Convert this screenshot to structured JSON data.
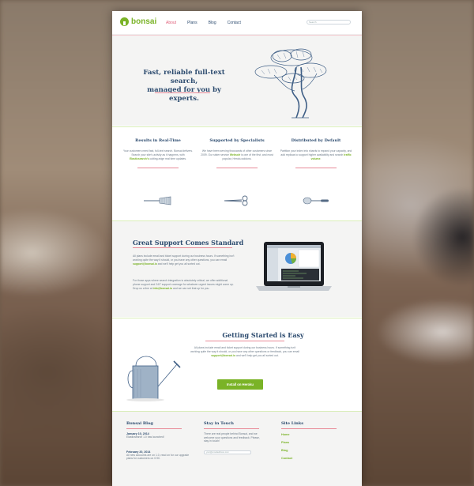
{
  "brand": {
    "name": "bonsai",
    "color": "#7ab327"
  },
  "nav": {
    "items": [
      "About",
      "Plans",
      "Blog",
      "Contact"
    ],
    "active": "About"
  },
  "search": {
    "placeholder": "Search"
  },
  "hero": {
    "title_line1": "Fast, reliable full-text search,",
    "title_line2": "managed for you by experts."
  },
  "features": [
    {
      "title": "Results in Real-Time",
      "text_a": "Your customers need fast, full-text search. Bonsai delivers. Search your site's activity as it happens, with ",
      "link": "Elasticsearch's",
      "text_b": " cutting-edge real time updates.",
      "icon": "broom-icon"
    },
    {
      "title": "Supported by Specialists",
      "text_a": "We have been serving thousands of other customers since 2009. Our sister service ",
      "link": "Websolr",
      "text_b": " is one of the first, and most popular, Heroku addons.",
      "icon": "scissors-icon"
    },
    {
      "title": "Distributed by Default",
      "text_a": "Partition your index into shards to expand your capacity, and add replicas to support higher availability and search ",
      "link": "traffic volume",
      "text_b": ".",
      "icon": "trowel-icon"
    }
  ],
  "support": {
    "title": "Great Support Comes Standard",
    "p1_a": "All plans include email and ticket support during our business hours. If something isn't working quite the way it should, or you have any other questions, you can email ",
    "p1_link": "support@bonsai.io",
    "p1_b": " and we'll help get you all sorted out.",
    "p2_a": "For those apps where search integration is absolutely critical, we offer additional phone support and 24/7 support coverage for whatever urgent issues might come up. Drop us a line at ",
    "p2_link": "info@bonsai.io",
    "p2_b": " and we can set that up for you."
  },
  "started": {
    "title": "Getting Started is Easy",
    "text_a": "All plans include email and ticket support during our business hours. If something isn't working quite the way it should, or you have any other questions or feedback, you can email ",
    "link": "support@bonsai.io",
    "text_b": " and we'll help get you all sorted out.",
    "button": "Install on Heroku"
  },
  "footer": {
    "blog": {
      "title": "Bonsai Blog",
      "posts": [
        {
          "date": "January 10, 2014",
          "text": "Elasticsearch 1.0 has launched!"
        },
        {
          "date": "February 20, 2014",
          "text": "All new accounts are on 1.0, read on for our upgrade plans for customers on 0.90."
        }
      ]
    },
    "touch": {
      "title": "Stay in Touch",
      "text": "There are real people behind Bonsai, and we welcome your questions and feedback. Please, stay in touch!",
      "input_placeholder": "your@emailaddress.com"
    },
    "links": {
      "title": "Site Links",
      "items": [
        "Home",
        "Plans",
        "Blog",
        "Contact"
      ]
    }
  }
}
